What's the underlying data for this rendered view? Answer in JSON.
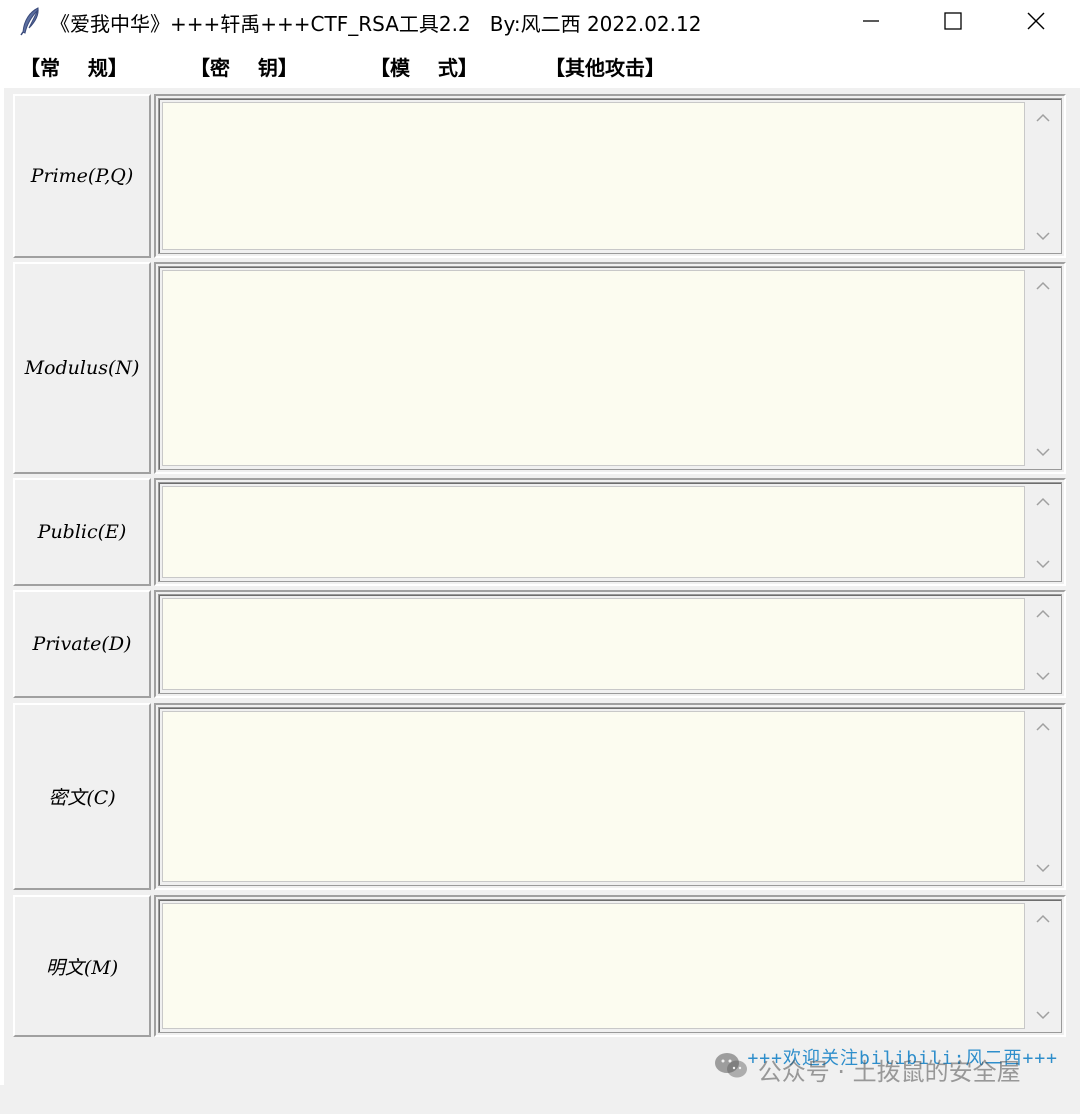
{
  "window": {
    "title": "《爱我中华》+++轩禹+++CTF_RSA工具2.2   By:风二西 2022.02.12"
  },
  "menu": {
    "items": [
      {
        "label": "【常    规】"
      },
      {
        "label": "【密    钥】"
      },
      {
        "label": "【模    式】"
      },
      {
        "label": "【其他攻击】"
      }
    ]
  },
  "fields": {
    "prime": {
      "label": "Prime(P,Q)",
      "value": ""
    },
    "modulus": {
      "label": "Modulus(N)",
      "value": ""
    },
    "public": {
      "label": "Public(E)",
      "value": ""
    },
    "private": {
      "label": "Private(D)",
      "value": ""
    },
    "ciphertext": {
      "label": "密文(C)",
      "value": ""
    },
    "plaintext": {
      "label": "明文(M)",
      "value": ""
    }
  },
  "footer": {
    "text": "+++欢迎关注bilibili:风二西+++"
  },
  "watermark": {
    "text": "公众号 · 土拨鼠的安全屋",
    "icon": "wechat-icon"
  },
  "colors": {
    "textarea_bg": "#fcfcf0",
    "footer_text": "#2e8ecb",
    "window_bg": "#f0f0f0"
  }
}
